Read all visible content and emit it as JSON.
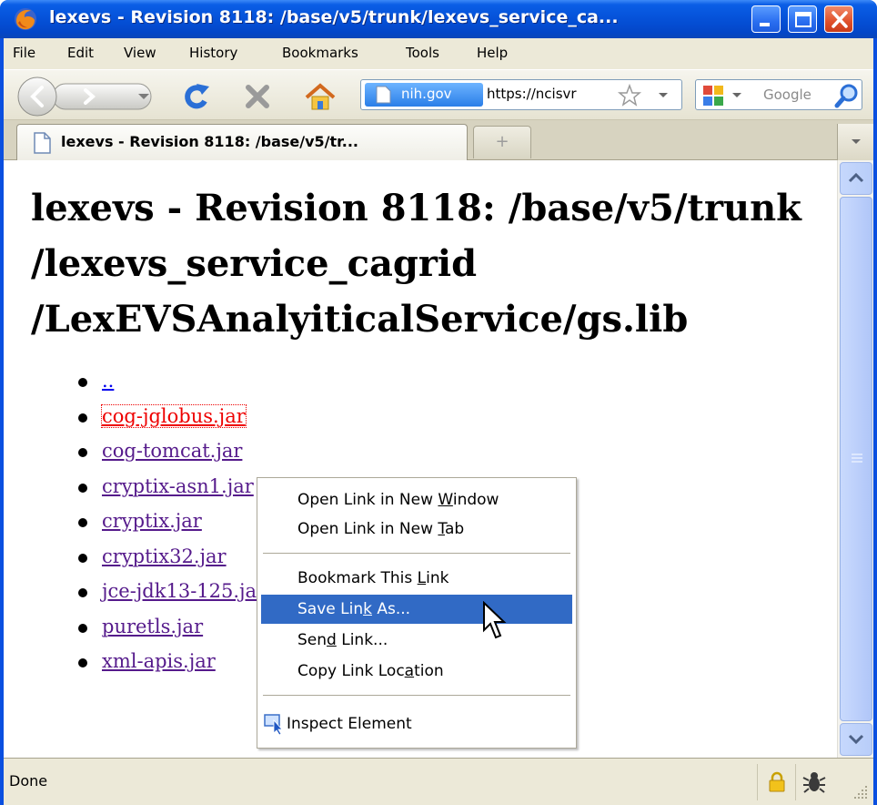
{
  "window": {
    "title": "lexevs - Revision 8118: /base/v5/trunk/lexevs_service_ca...",
    "colors": {
      "titlebar": "#0551d8",
      "selection": "#316ac5",
      "visited_link": "#551a8b",
      "active_link": "#ee0000"
    }
  },
  "menubar": {
    "items": [
      "File",
      "Edit",
      "View",
      "History",
      "Bookmarks",
      "Tools",
      "Help"
    ]
  },
  "navbar": {
    "site_identity": "nih.gov",
    "url": "https://ncisvr",
    "search_placeholder": "Google"
  },
  "tabs": {
    "active_label": "lexevs - Revision 8118: /base/v5/tr...",
    "new_tab_symbol": "+"
  },
  "page": {
    "title": "lexevs - Revision 8118: /base/v5/trunk /lexevs_service_cagrid /LexEVSAnalyiticalService/gs.lib",
    "links": [
      "..",
      "cog-jglobus.jar",
      "cog-tomcat.jar",
      "cryptix-asn1.jar",
      "cryptix.jar",
      "cryptix32.jar",
      "jce-jdk13-125.jar",
      "puretls.jar",
      "xml-apis.jar"
    ]
  },
  "context_menu": {
    "open_new_window": {
      "before": "Open Link in New ",
      "u": "W",
      "after": "indow"
    },
    "open_new_tab": {
      "before": "Open Link in New ",
      "u": "T",
      "after": "ab"
    },
    "bookmark_link": {
      "before": "Bookmark This ",
      "u": "L",
      "after": "ink"
    },
    "save_link_as": {
      "before": "Save Lin",
      "u": "k",
      "after": " As..."
    },
    "send_link": {
      "before": "Sen",
      "u": "d",
      "after": " Link..."
    },
    "copy_link_location": {
      "before": "Copy Link Loc",
      "u": "a",
      "after": "tion"
    },
    "inspect_element": "Inspect Element"
  },
  "statusbar": {
    "text": "Done"
  }
}
